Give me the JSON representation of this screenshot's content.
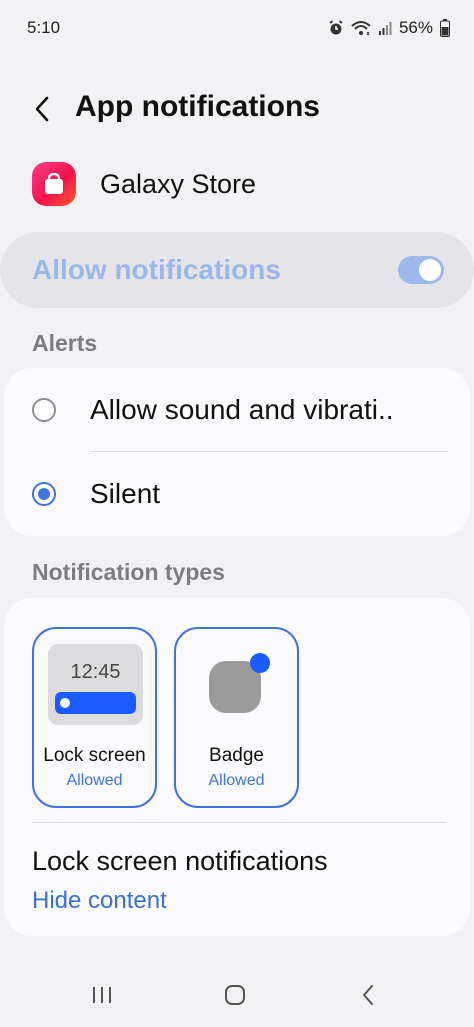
{
  "status_bar": {
    "time": "5:10",
    "battery": "56%",
    "icons": [
      "alarm-icon",
      "wifi-icon",
      "signal-icon",
      "battery-icon"
    ]
  },
  "header": {
    "title": "App notifications",
    "back_icon": "back-arrow-icon"
  },
  "app": {
    "name": "Galaxy Store",
    "icon": "galaxy-store-icon",
    "icon_colors": [
      "#ff3d8a",
      "#f0144b",
      "#ff5a2a"
    ]
  },
  "allow_notifications": {
    "label": "Allow notifications",
    "enabled": true
  },
  "alerts": {
    "header": "Alerts",
    "options": [
      {
        "label": "Allow sound and vibrati..",
        "selected": false
      },
      {
        "label": "Silent",
        "selected": true
      }
    ]
  },
  "notification_types": {
    "header": "Notification types",
    "tiles": [
      {
        "label": "Lock screen",
        "status": "Allowed",
        "preview_time": "12:45"
      },
      {
        "label": "Badge",
        "status": "Allowed"
      }
    ],
    "lock_screen_notifications": {
      "title": "Lock screen notifications",
      "value": "Hide content"
    }
  },
  "colors": {
    "accent": "#3e73e0",
    "toggle_on": "#9cb9ea",
    "background": "#f2f2f4"
  },
  "nav_bar": {
    "icons": [
      "recents-icon",
      "home-icon",
      "back-icon"
    ]
  }
}
